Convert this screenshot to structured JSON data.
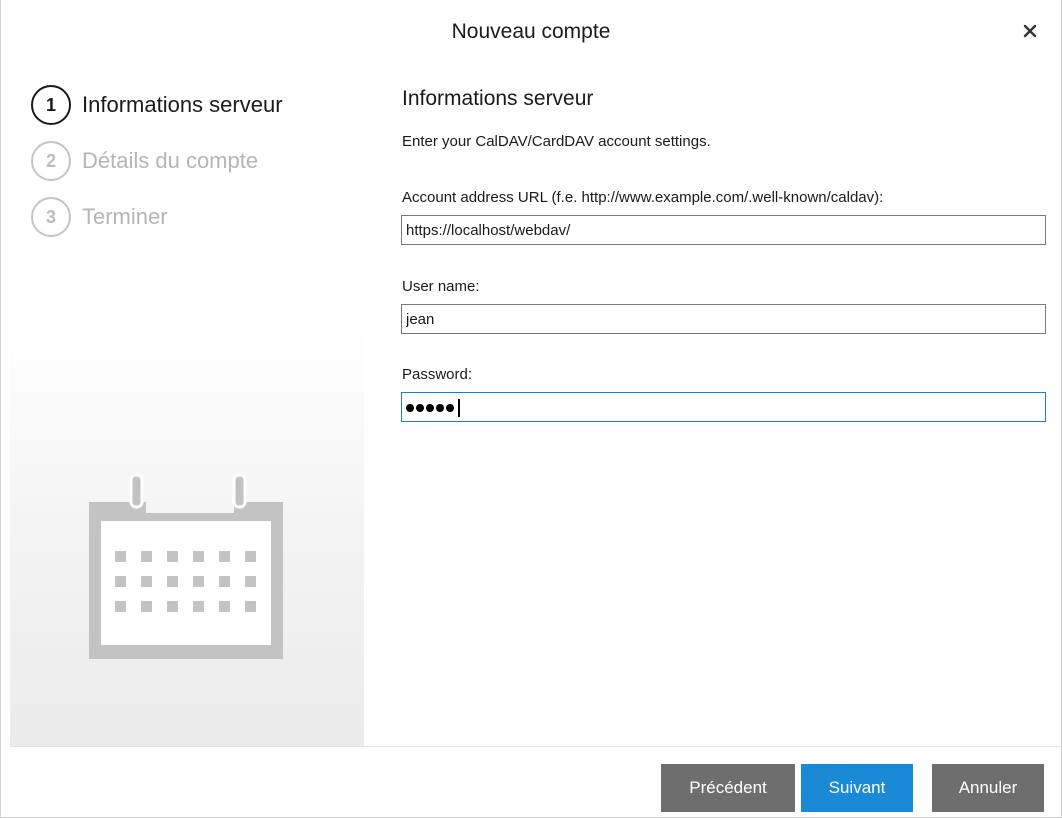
{
  "window": {
    "title": "Nouveau compte",
    "close_icon": "close-icon"
  },
  "steps": [
    {
      "number": "1",
      "label": "Informations serveur",
      "state": "active"
    },
    {
      "number": "2",
      "label": "Détails du compte",
      "state": "inactive"
    },
    {
      "number": "3",
      "label": "Terminer",
      "state": "inactive"
    }
  ],
  "illustration": {
    "icon": "calendar-icon"
  },
  "form": {
    "section_title": "Informations serveur",
    "description": "Enter your CalDAV/CardDAV account settings.",
    "url_label": "Account address URL (f.e. http://www.example.com/.well-known/caldav):",
    "url_value": "https://localhost/webdav/",
    "user_label": "User name:",
    "user_value": "jean",
    "password_label": "Password:",
    "password_masked_length": 5
  },
  "buttons": {
    "prev": "Précédent",
    "next": "Suivant",
    "cancel": "Annuler"
  },
  "colors": {
    "accent": "#1b8ad6",
    "button_gray": "#6e6e6e",
    "inactive_text": "#b5b5b5"
  }
}
